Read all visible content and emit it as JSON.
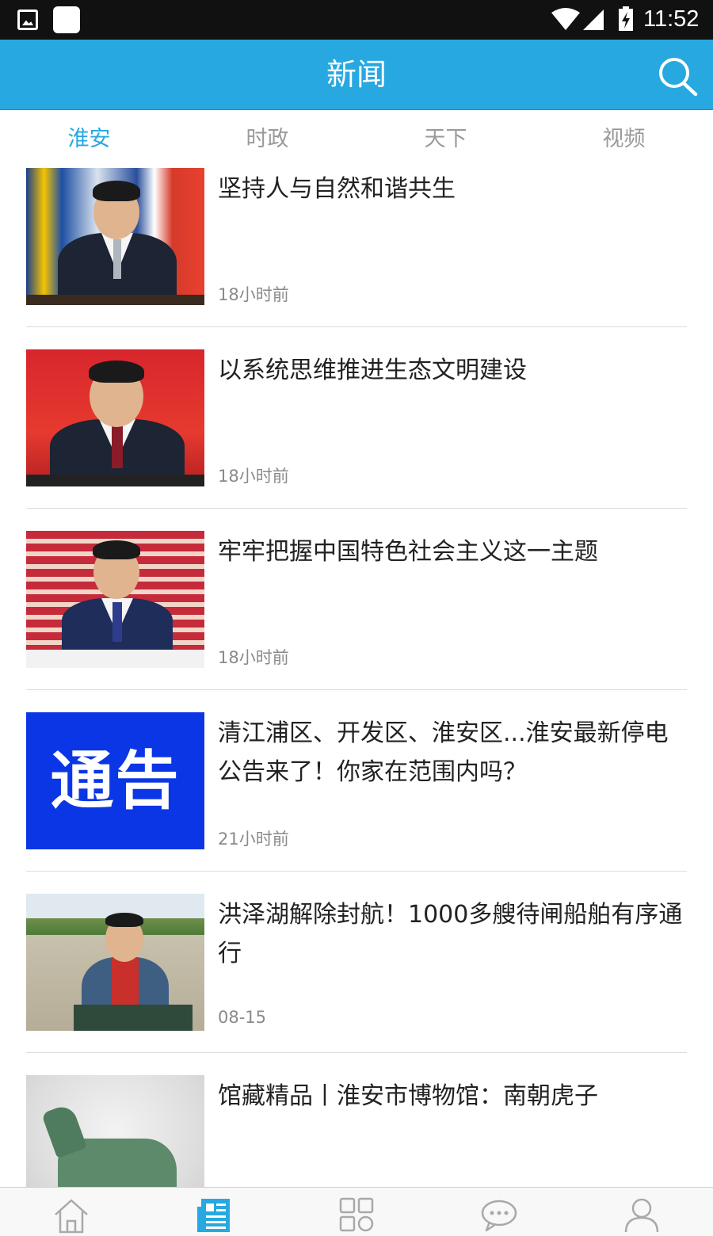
{
  "status_bar": {
    "time": "11:52",
    "icons": [
      "gallery-icon",
      "app-icon",
      "wifi-icon",
      "signal-icon",
      "battery-charging-icon"
    ]
  },
  "app_bar": {
    "title": "新闻",
    "search_icon": "search-icon"
  },
  "tabs": [
    {
      "label": "淮安",
      "active": true
    },
    {
      "label": "时政",
      "active": false
    },
    {
      "label": "天下",
      "active": false
    },
    {
      "label": "视频",
      "active": false
    }
  ],
  "news": [
    {
      "title": "坚持人与自然和谐共生",
      "time": "18小时前"
    },
    {
      "title": "以系统思维推进生态文明建设",
      "time": "18小时前"
    },
    {
      "title": "牢牢把握中国特色社会主义这一主题",
      "time": "18小时前"
    },
    {
      "title": "清江浦区、开发区、淮安区...淮安最新停电公告来了！你家在范围内吗？",
      "time": "21小时前",
      "thumb_text": "通告"
    },
    {
      "title": "洪泽湖解除封航！1000多艘待闸船舶有序通行",
      "time": "08-15"
    },
    {
      "title": "馆藏精品丨淮安市博物馆：南朝虎子",
      "time": ""
    }
  ],
  "bottom_nav": [
    {
      "icon": "home-icon",
      "active": false
    },
    {
      "icon": "news-icon",
      "active": true
    },
    {
      "icon": "apps-grid-icon",
      "active": false
    },
    {
      "icon": "chat-icon",
      "active": false
    },
    {
      "icon": "user-icon",
      "active": false
    }
  ],
  "colors": {
    "accent": "#27a8e0",
    "status_bar": "#111111",
    "text": "#222222",
    "muted": "#8a8a8a"
  }
}
